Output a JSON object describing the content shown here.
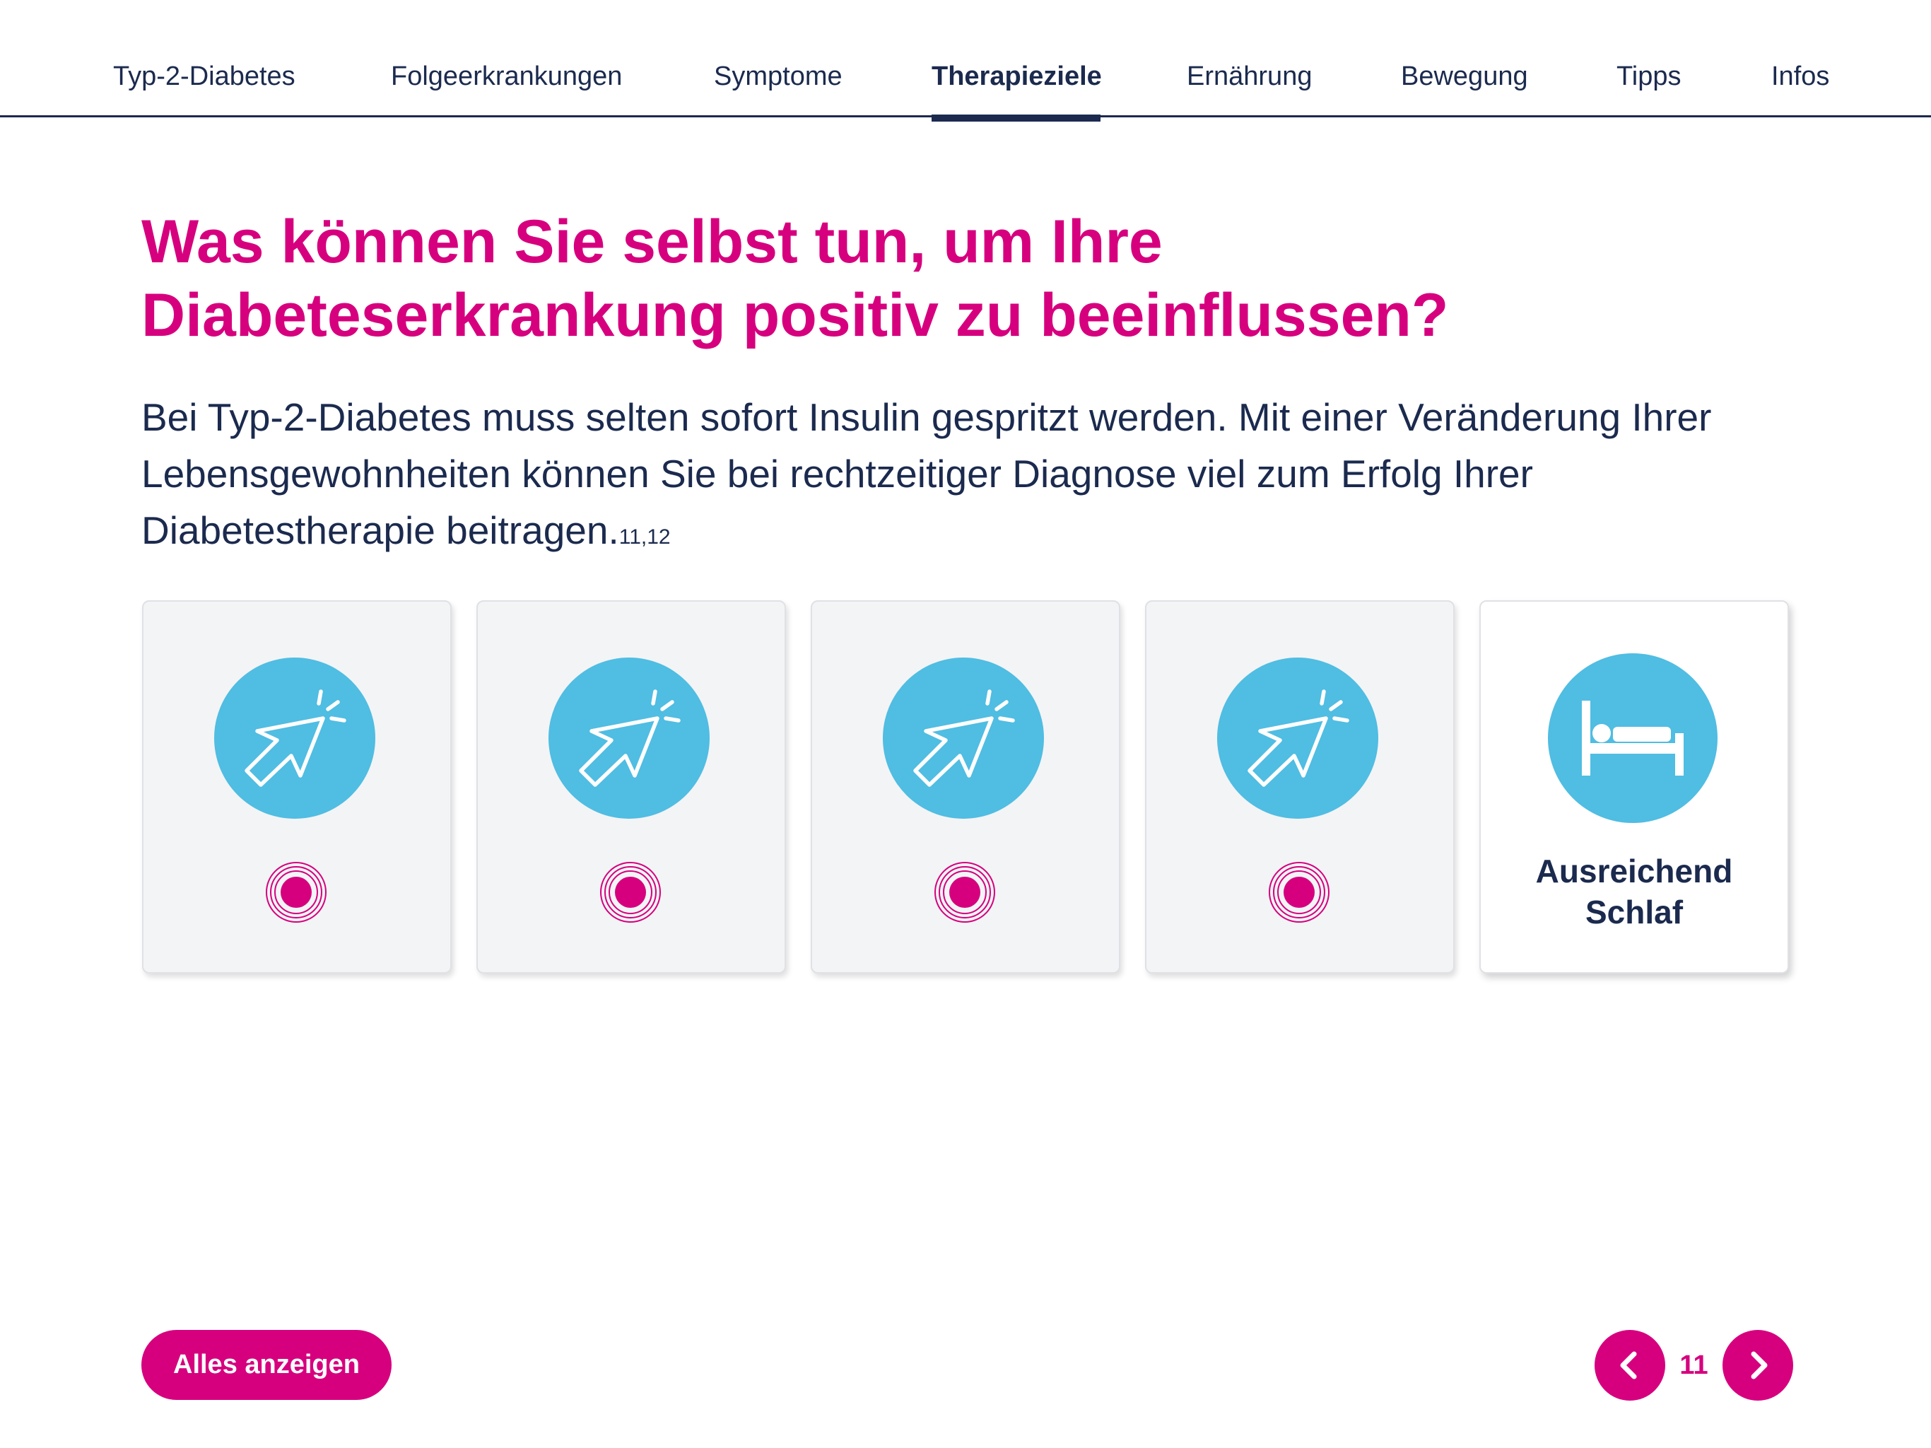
{
  "nav": {
    "items": [
      {
        "label": "Typ-2-Diabetes"
      },
      {
        "label": "Folgeerkrankungen"
      },
      {
        "label": "Symptome"
      },
      {
        "label": "Therapieziele",
        "active": true
      },
      {
        "label": "Ernährung"
      },
      {
        "label": "Bewegung"
      },
      {
        "label": "Tipps"
      },
      {
        "label": "Infos"
      }
    ]
  },
  "headline": {
    "line1": "Was können Sie selbst tun, um Ihre",
    "line2": "Diabeteserkrankung positiv zu beeinflussen?"
  },
  "intro": {
    "text": "Bei Typ-2-Diabetes muss selten sofort Insulin gespritzt werden. Mit einer Veränderung Ihrer Lebensgewohnheiten können Sie bei rechtzeitiger Diagnose viel zum Erfolg Ihrer Diabetestherapie beitragen.",
    "footnote": "11,12"
  },
  "cards": [
    {
      "state": "hidden",
      "icon": "cursor-click-icon"
    },
    {
      "state": "hidden",
      "icon": "cursor-click-icon"
    },
    {
      "state": "hidden",
      "icon": "cursor-click-icon"
    },
    {
      "state": "hidden",
      "icon": "cursor-click-icon"
    },
    {
      "state": "revealed",
      "icon": "bed-icon",
      "label": "Ausreichend\nSchlaf"
    }
  ],
  "footer": {
    "show_all_label": "Alles anzeigen",
    "page_number": "11"
  },
  "colors": {
    "accent": "#d6007e",
    "navy": "#1b2a4e",
    "icon_circle": "#50bde2",
    "card_bg": "#f3f4f6"
  }
}
